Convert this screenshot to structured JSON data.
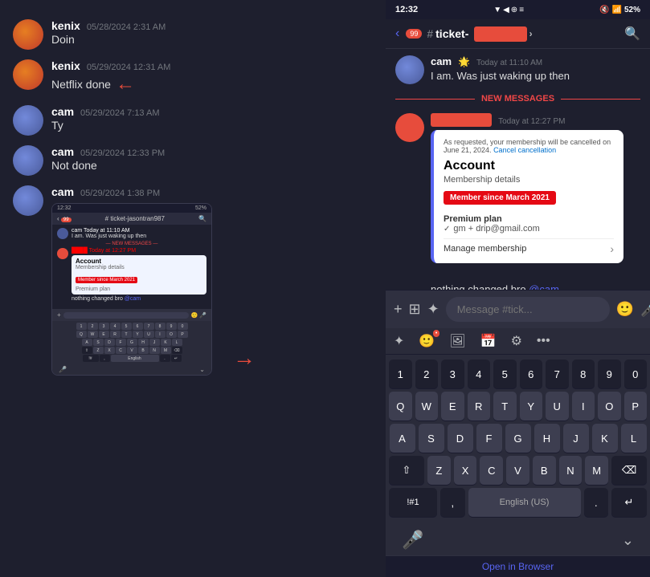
{
  "leftPanel": {
    "messages": [
      {
        "id": "msg1",
        "username": "kenix",
        "timestamp": "05/28/2024 2:31 AM",
        "text": "Doin",
        "avatar_type": "kenix",
        "hasArrow": false,
        "hasScreenshot": false
      },
      {
        "id": "msg2",
        "username": "kenix",
        "timestamp": "05/29/2024 12:31 AM",
        "text": "Netflix done",
        "avatar_type": "kenix",
        "hasArrow": true,
        "hasScreenshot": false
      },
      {
        "id": "msg3",
        "username": "cam",
        "timestamp": "05/29/2024 7:13 AM",
        "text": "Ty",
        "avatar_type": "cam",
        "hasArrow": false,
        "hasScreenshot": false
      },
      {
        "id": "msg4",
        "username": "cam",
        "timestamp": "05/29/2024 12:33 PM",
        "text": "Not done",
        "avatar_type": "cam",
        "hasArrow": false,
        "hasScreenshot": false
      },
      {
        "id": "msg5",
        "username": "cam",
        "timestamp": "05/29/2024 1:38 PM",
        "text": "",
        "avatar_type": "cam",
        "hasArrow": false,
        "hasScreenshot": true
      }
    ]
  },
  "rightPanel": {
    "statusBar": {
      "time": "12:32",
      "icons": "▼ ◀ ⊕ ≡",
      "rightIcons": "🔇 📶 52%"
    },
    "channelHeader": {
      "backLabel": "‹",
      "notifCount": "99",
      "hashIcon": "#",
      "channelName": "ticket-",
      "searchIcon": "🔍",
      "chevronIcon": "›"
    },
    "messages": [
      {
        "id": "r_msg1",
        "username": "cam",
        "hasEmoji": true,
        "timestamp": "Today at 11:10 AM",
        "text": "I am.  Was just waking up then",
        "avatar_type": "cam_avatar"
      }
    ],
    "newMessages": {
      "label": "NEW MESSAGES"
    },
    "secondMessage": {
      "username": "blurred",
      "timestamp": "Today at 12:27 PM",
      "accountCard": {
        "noticeText": "As requested, your membership will be cancelled on June 21, 2024.",
        "cancelLink": "Cancel cancellation",
        "title": "Account",
        "subtitle": "Membership details",
        "badge": "Member since March 2021",
        "premiumLabel": "Premium plan",
        "premiumValue": "gm + drip@gmail.com",
        "manageText": "Manage membership",
        "manageArrow": "›"
      }
    },
    "thirdMessage": {
      "text": "nothing changed bro ",
      "mention": "@cam"
    },
    "inputBar": {
      "plusIcon": "+",
      "gridIcon": "⊞",
      "stickerIcon": "✦",
      "placeholder": "Message #tick...",
      "emojiIcon": "🙂",
      "micIcon": "🎤"
    },
    "quickActions": {
      "starIcon": "✦",
      "emojiIcon": "🙂",
      "imageIcon": "🖼",
      "calIcon": "📅",
      "gearIcon": "⚙",
      "moreIcon": "•••"
    },
    "keyboard": {
      "rows": [
        [
          "1",
          "2",
          "3",
          "4",
          "5",
          "6",
          "7",
          "8",
          "9",
          "0"
        ],
        [
          "Q",
          "W",
          "E",
          "R",
          "T",
          "Y",
          "U",
          "I",
          "O",
          "P"
        ],
        [
          "A",
          "S",
          "D",
          "F",
          "G",
          "H",
          "J",
          "K",
          "L"
        ],
        [
          "⇧",
          "Z",
          "X",
          "C",
          "V",
          "B",
          "N",
          "M",
          "⌫"
        ],
        [
          "!#1",
          ",",
          "English (US)",
          ".",
          "↵"
        ]
      ]
    },
    "micBar": {
      "micIcon": "🎤",
      "chevronIcon": "⌄"
    },
    "openInBrowser": "Open in Browser"
  }
}
